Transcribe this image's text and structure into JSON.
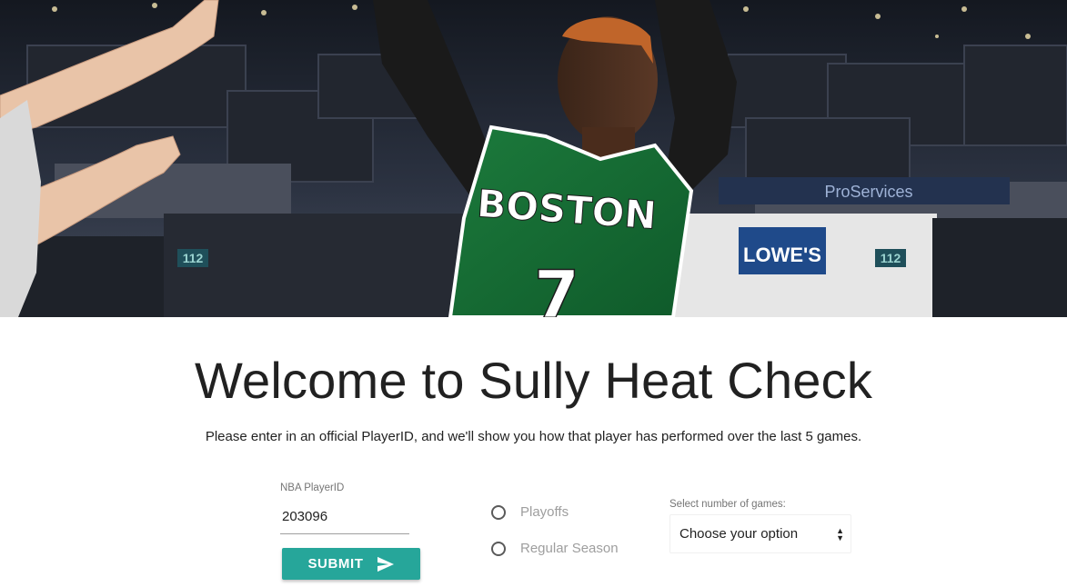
{
  "hero": {
    "jersey_team": "BOSTON",
    "jersey_number": "7",
    "sign_brand": "LOWE'S",
    "banner_text": "ProServices",
    "section_number": "112"
  },
  "main": {
    "title": "Welcome to Sully Heat Check",
    "subtitle": "Please enter in an official PlayerID, and we'll show you how that player has performed over the last 5 games."
  },
  "form": {
    "player_id_label": "NBA PlayerID",
    "player_id_value": "203096",
    "submit_label": "SUBMIT",
    "submit_icon": "send-icon",
    "radio_options": [
      "Playoffs",
      "Regular Season"
    ],
    "games_label": "Select number of games:",
    "games_selected": "Choose your option",
    "accent_color": "#26a69a"
  }
}
